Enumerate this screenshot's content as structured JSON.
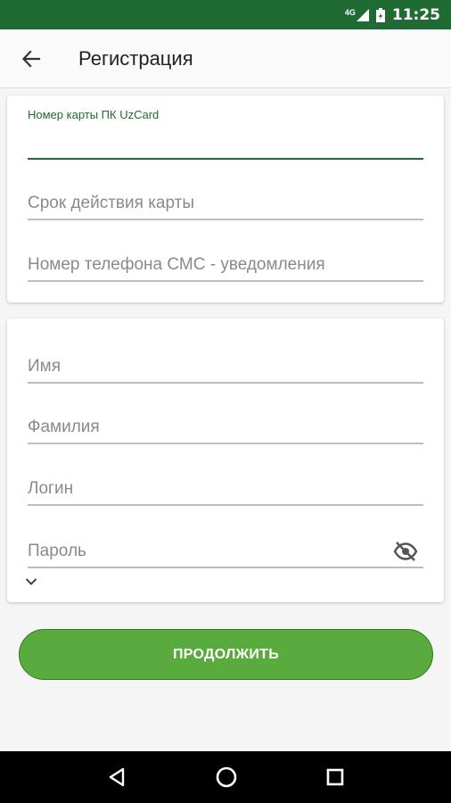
{
  "status_bar": {
    "network": "4G",
    "time": "11:25"
  },
  "app_bar": {
    "title": "Регистрация"
  },
  "card_section": {
    "card_number": {
      "label": "Номер карты ПК UzCard",
      "value": ""
    },
    "card_expiry": {
      "placeholder": "Срок действия карты"
    },
    "sms_phone": {
      "placeholder": "Номер телефона СМС - уведомления"
    }
  },
  "user_section": {
    "first_name": {
      "placeholder": "Имя"
    },
    "last_name": {
      "placeholder": "Фамилия"
    },
    "login": {
      "placeholder": "Логин"
    },
    "password": {
      "placeholder": "Пароль"
    }
  },
  "continue_label": "ПРОДОЛЖИТЬ",
  "colors": {
    "primary_dark": "#1f6b33",
    "button_green": "#5aab3d"
  },
  "icons": [
    "back-arrow-icon",
    "eye-off-icon",
    "chevron-down-icon",
    "signal-icon",
    "battery-icon",
    "nav-back-icon",
    "nav-home-icon",
    "nav-recents-icon"
  ]
}
